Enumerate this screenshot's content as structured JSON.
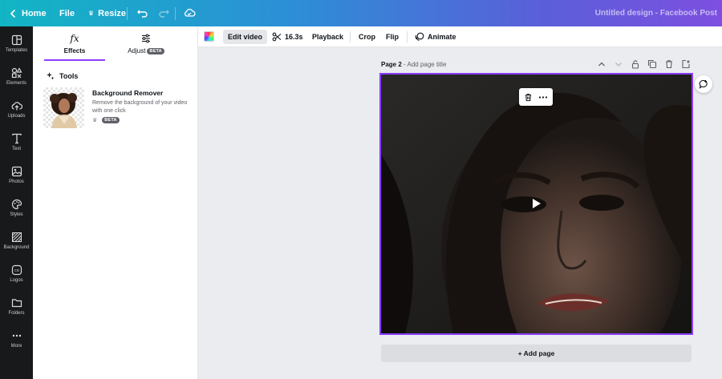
{
  "topbar": {
    "home_label": "Home",
    "file_label": "File",
    "resize_label": "Resize",
    "doc_title": "Untitled design - Facebook Post"
  },
  "rail": {
    "items": [
      {
        "label": "Templates",
        "icon": "templates-icon"
      },
      {
        "label": "Elements",
        "icon": "elements-icon"
      },
      {
        "label": "Uploads",
        "icon": "uploads-icon"
      },
      {
        "label": "Text",
        "icon": "text-icon"
      },
      {
        "label": "Photos",
        "icon": "photos-icon"
      },
      {
        "label": "Styles",
        "icon": "styles-icon"
      },
      {
        "label": "Background",
        "icon": "background-icon"
      },
      {
        "label": "Logos",
        "icon": "logos-icon"
      },
      {
        "label": "Folders",
        "icon": "folders-icon"
      },
      {
        "label": "More",
        "icon": "more-icon"
      }
    ]
  },
  "panel": {
    "tabs": [
      {
        "label": "Effects",
        "icon_text": "fx"
      },
      {
        "label": "Adjust",
        "badge": "BETA"
      }
    ],
    "tools_heading": "Tools",
    "tool": {
      "name": "Background Remover",
      "description": "Remove the background of your video with one click",
      "badge": "BETA"
    }
  },
  "context_toolbar": {
    "edit_video": "Edit video",
    "duration": "16.3s",
    "playback": "Playback",
    "crop": "Crop",
    "flip": "Flip",
    "animate": "Animate"
  },
  "canvas": {
    "page_label": "Page 2",
    "page_title_placeholder": "- Add page title",
    "add_page": "+ Add page"
  },
  "colors": {
    "accent": "#8b3dff",
    "rail_bg": "#18191b",
    "canvas_bg": "#ebecf0"
  }
}
